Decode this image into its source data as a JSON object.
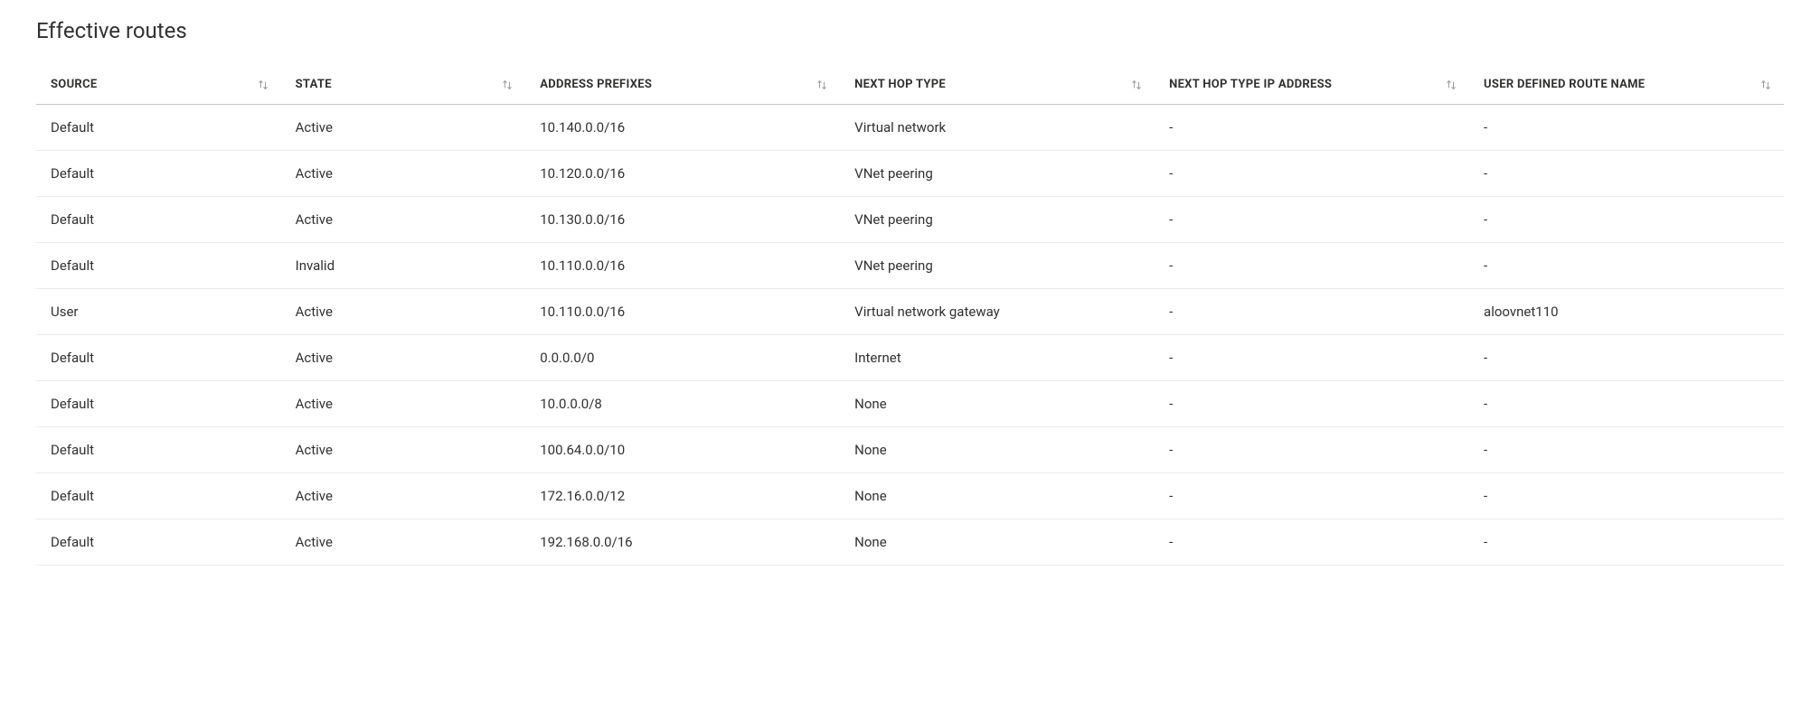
{
  "title": "Effective routes",
  "columns": {
    "source": "Source",
    "state": "State",
    "address_prefixes": "Address Prefixes",
    "next_hop_type": "Next Hop Type",
    "next_hop_ip": "Next Hop Type IP Address",
    "udr_name": "User Defined Route Name"
  },
  "rows": [
    {
      "source": "Default",
      "state": "Active",
      "address_prefixes": "10.140.0.0/16",
      "next_hop_type": "Virtual network",
      "next_hop_ip": "-",
      "udr_name": "-"
    },
    {
      "source": "Default",
      "state": "Active",
      "address_prefixes": "10.120.0.0/16",
      "next_hop_type": "VNet peering",
      "next_hop_ip": "-",
      "udr_name": "-"
    },
    {
      "source": "Default",
      "state": "Active",
      "address_prefixes": "10.130.0.0/16",
      "next_hop_type": "VNet peering",
      "next_hop_ip": "-",
      "udr_name": "-"
    },
    {
      "source": "Default",
      "state": "Invalid",
      "address_prefixes": "10.110.0.0/16",
      "next_hop_type": "VNet peering",
      "next_hop_ip": "-",
      "udr_name": "-"
    },
    {
      "source": "User",
      "state": "Active",
      "address_prefixes": "10.110.0.0/16",
      "next_hop_type": "Virtual network gateway",
      "next_hop_ip": "-",
      "udr_name": "aloovnet110"
    },
    {
      "source": "Default",
      "state": "Active",
      "address_prefixes": "0.0.0.0/0",
      "next_hop_type": "Internet",
      "next_hop_ip": "-",
      "udr_name": "-"
    },
    {
      "source": "Default",
      "state": "Active",
      "address_prefixes": "10.0.0.0/8",
      "next_hop_type": "None",
      "next_hop_ip": "-",
      "udr_name": "-"
    },
    {
      "source": "Default",
      "state": "Active",
      "address_prefixes": "100.64.0.0/10",
      "next_hop_type": "None",
      "next_hop_ip": "-",
      "udr_name": "-"
    },
    {
      "source": "Default",
      "state": "Active",
      "address_prefixes": "172.16.0.0/12",
      "next_hop_type": "None",
      "next_hop_ip": "-",
      "udr_name": "-"
    },
    {
      "source": "Default",
      "state": "Active",
      "address_prefixes": "192.168.0.0/16",
      "next_hop_type": "None",
      "next_hop_ip": "-",
      "udr_name": "-"
    }
  ]
}
